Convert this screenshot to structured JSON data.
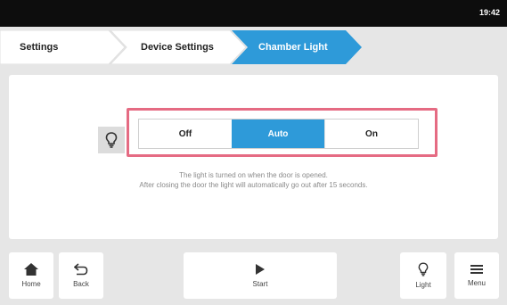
{
  "status": {
    "time": "19:42"
  },
  "breadcrumb": [
    {
      "label": "Settings"
    },
    {
      "label": "Device Settings"
    },
    {
      "label": "Chamber Light",
      "active": true
    }
  ],
  "light_mode": {
    "options": [
      "Off",
      "Auto",
      "On"
    ],
    "selected": "Auto",
    "description_line1": "The light is turned on when the door is opened.",
    "description_line2": "After closing the door the light will automatically go out after 15 seconds."
  },
  "bottom_nav": {
    "home": "Home",
    "back": "Back",
    "start": "Start",
    "light": "Light",
    "menu": "Menu"
  },
  "colors": {
    "accent": "#2e9ad9",
    "highlight": "#e56b83",
    "status_bar": "#0d0d0d"
  }
}
